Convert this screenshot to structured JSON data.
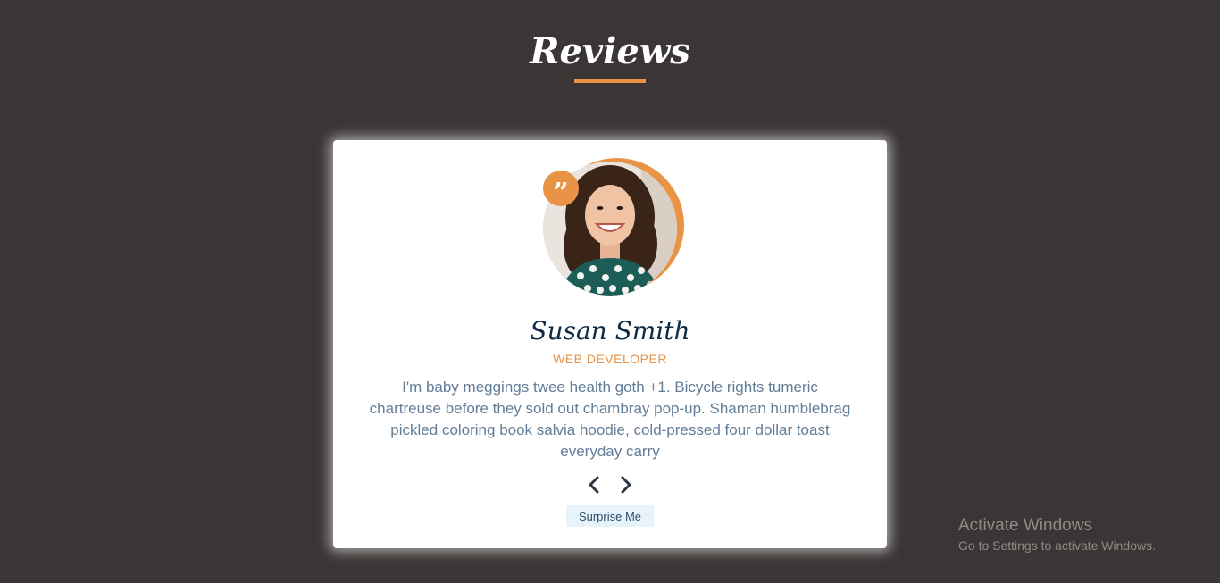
{
  "heading": {
    "title": "Reviews"
  },
  "review": {
    "name": "Susan Smith",
    "job": "WEB DEVELOPER",
    "text": "I'm baby meggings twee health goth +1. Bicycle rights tumeric chartreuse before they sold out chambray pop-up. Shaman humblebrag pickled coloring book salvia hoodie, cold-pressed four dollar toast everyday carry",
    "quote_glyph": "”"
  },
  "controls": {
    "prev_icon": "chevron-left-icon",
    "next_icon": "chevron-right-icon",
    "surprise_label": "Surprise Me"
  },
  "watermark": {
    "title": "Activate Windows",
    "subtitle": "Go to Settings to activate Windows."
  },
  "colors": {
    "background": "#3b3635",
    "accent": "#e89346",
    "card": "#ffffff",
    "name": "#102a43",
    "text": "#627d98",
    "button_bg": "#e6f3fb"
  }
}
